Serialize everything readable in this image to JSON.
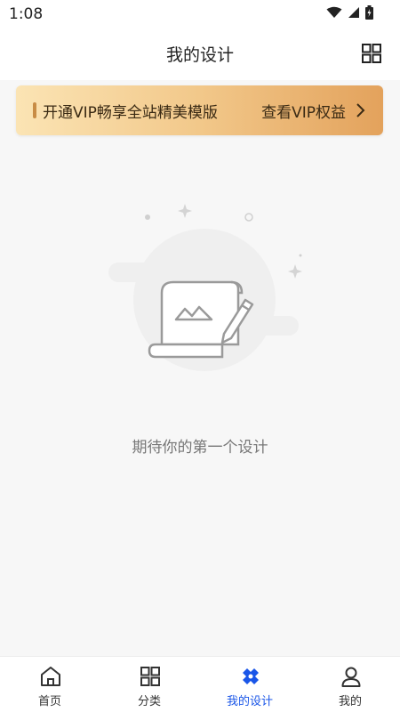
{
  "status_bar": {
    "time": "1:08"
  },
  "header": {
    "title": "我的设计",
    "grid_icon": "grid-icon"
  },
  "vip_banner": {
    "left_text": "开通VIP畅享全站精美模版",
    "right_text": "查看VIP权益"
  },
  "empty_state": {
    "text": "期待你的第一个设计"
  },
  "tabs": [
    {
      "label": "首页",
      "icon": "home-icon",
      "active": false
    },
    {
      "label": "分类",
      "icon": "category-icon",
      "active": false
    },
    {
      "label": "我的设计",
      "icon": "my-design-icon",
      "active": true
    },
    {
      "label": "我的",
      "icon": "user-icon",
      "active": false
    }
  ],
  "colors": {
    "accent": "#1a56e8",
    "vip_gradient_start": "#fbe4b4",
    "vip_gradient_end": "#e3a25c"
  }
}
